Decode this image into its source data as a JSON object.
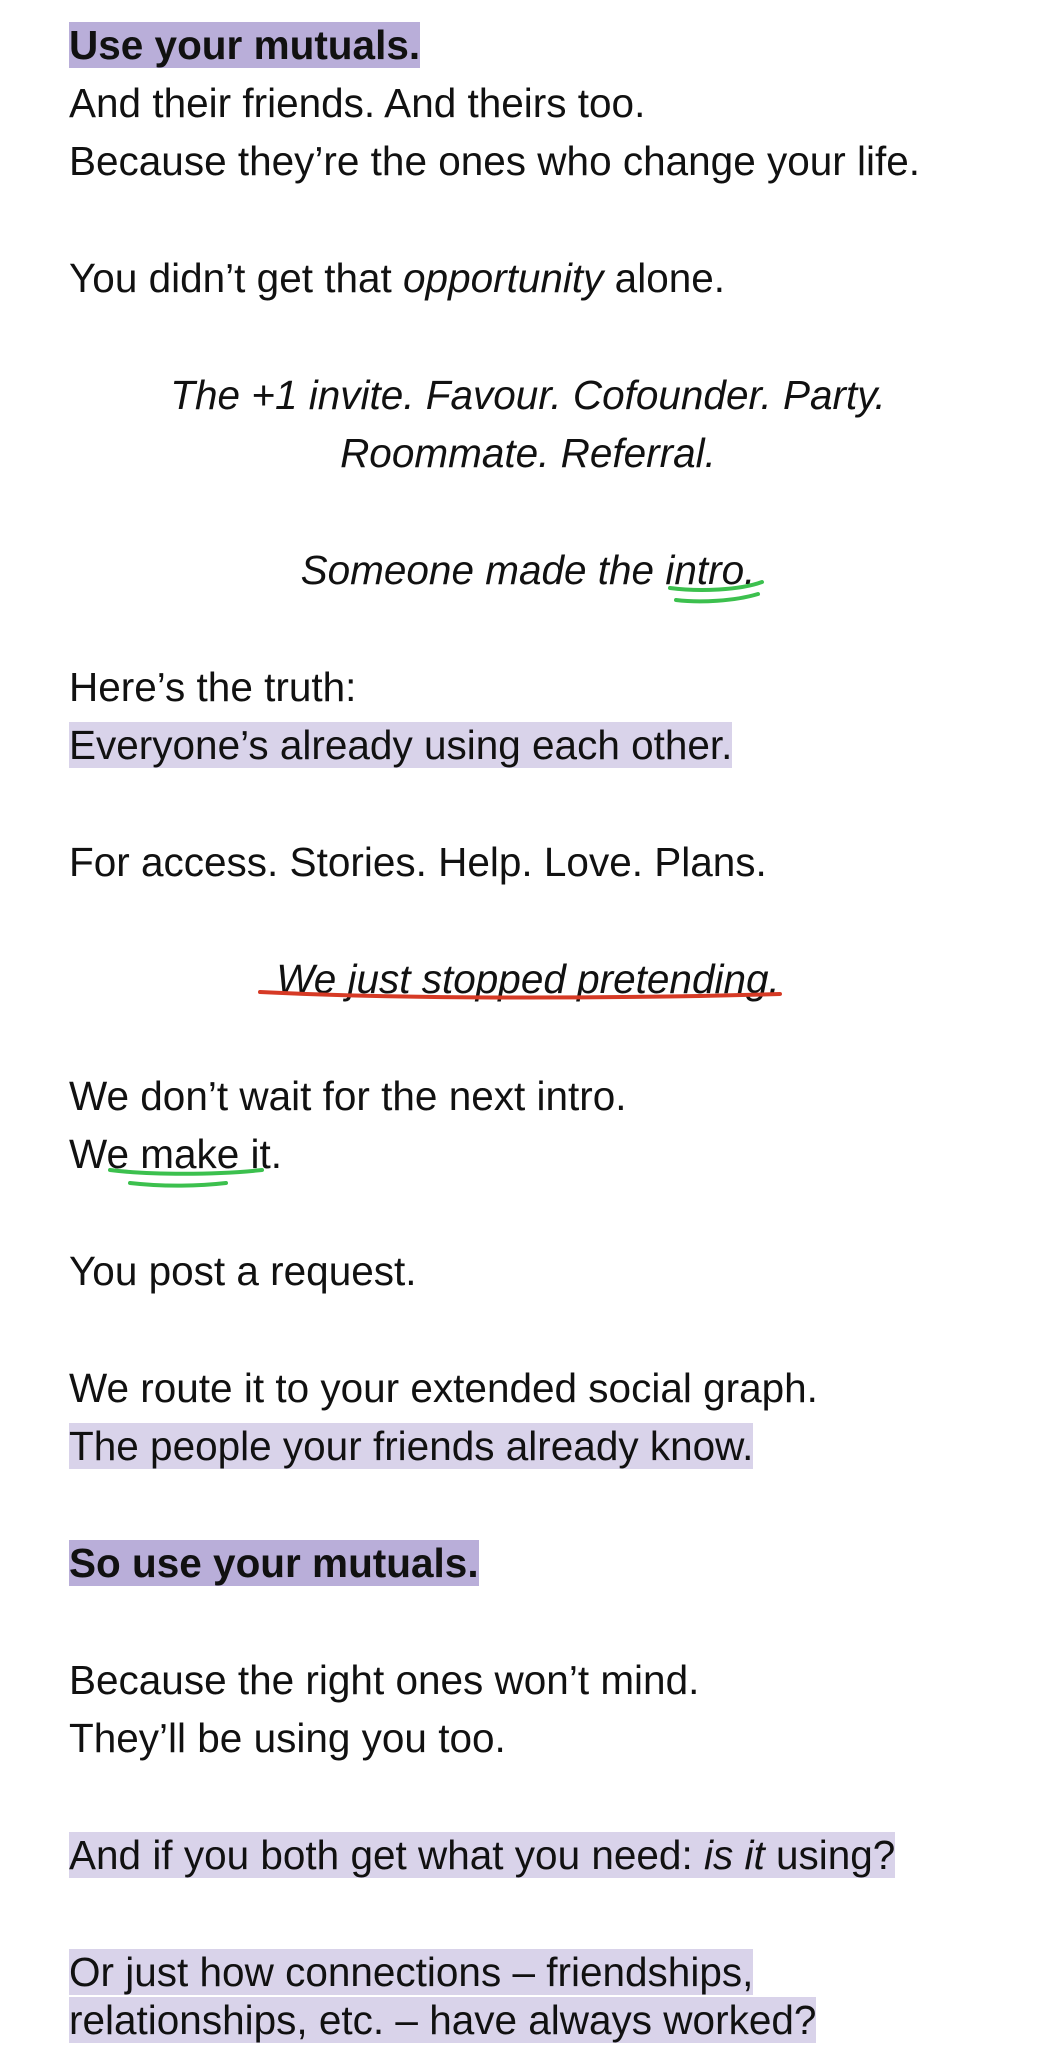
{
  "heading": "Use your mutuals.",
  "intro_line_1": "And their friends. And theirs too.",
  "intro_line_2": "Because they’re the ones who change your life.",
  "opportunity": {
    "pre": "You didn’t get that ",
    "emph": "opportunity",
    "post": " alone."
  },
  "list_line_1": "The +1 invite. Favour. Cofounder. Party.",
  "list_line_2": "Roommate. Referral.",
  "intro_made": {
    "pre": "Someone made the ",
    "word": "intro",
    "post": "."
  },
  "truth_label": "Here’s the truth:",
  "truth_statement": "Everyone’s already using each other.",
  "access_line": "For access. Stories. Help. Love. Plans.",
  "pretending_line": "We just stopped pretending.",
  "wait_line": "We don’t wait for the next intro.",
  "make_line": "We make it.",
  "request_line": "You post a request.",
  "route_line": "We route it to your extended social graph.",
  "people_line": "The people your friends already know.",
  "so_use_line": "So use your mutuals.",
  "mind_line": "Because the right ones won’t mind.",
  "using_you_line": "They’ll be using you too.",
  "question_line": {
    "pre": "And if you both get what you need: ",
    "emph": "is it",
    "post": " using?"
  },
  "closing_line_1": "Or just how connections –  friendships,",
  "closing_line_2": "relationships, etc. – have always worked?",
  "colors": {
    "highlight_strong": "#b9aed9",
    "highlight_soft": "#d9d3ea",
    "green_ink": "#3cc04e",
    "red_ink": "#d63a25"
  }
}
